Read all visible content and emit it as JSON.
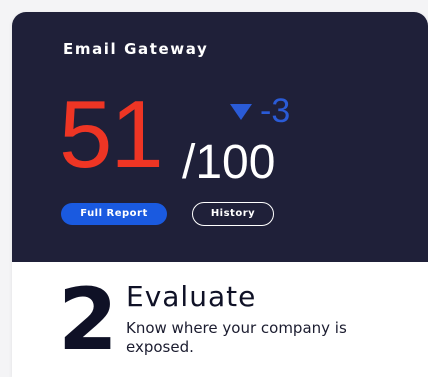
{
  "card": {
    "title": "Email Gateway",
    "score": "51",
    "total": "/100",
    "delta": "-3",
    "delta_direction": "down",
    "buttons": {
      "full_report": "Full Report",
      "history": "History"
    }
  },
  "step": {
    "number": "2",
    "title": "Evaluate",
    "description": "Know where your company is exposed."
  },
  "colors": {
    "panel_bg": "#1f2039",
    "score": "#ee3524",
    "delta": "#2a5bd7",
    "button_primary": "#1a5ae0",
    "text_dark": "#0f1126"
  },
  "icons": {
    "delta_indicator": "triangle-down-icon"
  }
}
